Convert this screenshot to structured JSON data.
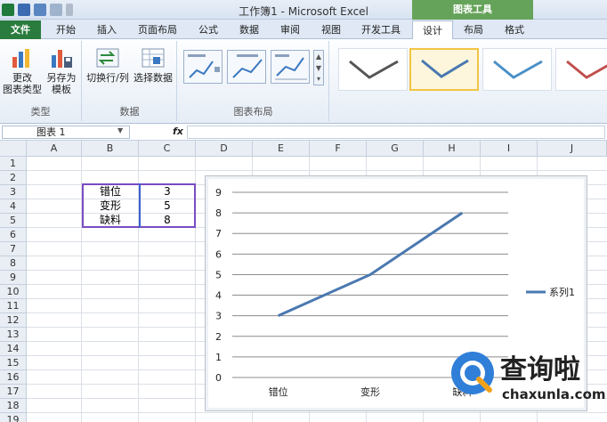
{
  "app": {
    "title": "工作簿1 - Microsoft Excel",
    "contextual_group": "图表工具"
  },
  "tabs": [
    {
      "label": "文件"
    },
    {
      "label": "开始"
    },
    {
      "label": "插入"
    },
    {
      "label": "页面布局"
    },
    {
      "label": "公式"
    },
    {
      "label": "数据"
    },
    {
      "label": "审阅"
    },
    {
      "label": "视图"
    },
    {
      "label": "开发工具"
    },
    {
      "label": "设计"
    },
    {
      "label": "布局"
    },
    {
      "label": "格式"
    }
  ],
  "ribbon": {
    "change_type_label": "更改\n图表类型",
    "save_template_label": "另存为\n模板",
    "switch_rowcol_label": "切换行/列",
    "select_data_label": "选择数据",
    "group_type": "类型",
    "group_data": "数据",
    "group_layout": "图表布局"
  },
  "formula_bar": {
    "name_box": "图表 1",
    "fx": "fx"
  },
  "sheet": {
    "columns": [
      "A",
      "B",
      "C",
      "D",
      "E",
      "F",
      "G",
      "H",
      "I",
      "J"
    ],
    "rows": [
      "1",
      "2",
      "3",
      "4",
      "5",
      "6",
      "7",
      "8",
      "9",
      "10",
      "11",
      "12",
      "13",
      "14",
      "15",
      "16",
      "17",
      "18",
      "19"
    ],
    "cells": [
      {
        "label": "错位",
        "value": "3"
      },
      {
        "label": "变形",
        "value": "5"
      },
      {
        "label": "缺料",
        "value": "8"
      }
    ]
  },
  "chart_data": {
    "type": "line",
    "categories": [
      "错位",
      "变形",
      "缺料"
    ],
    "series": [
      {
        "name": "系列1",
        "values": [
          3,
          5,
          8
        ]
      }
    ],
    "ylim": [
      0,
      9
    ],
    "yticks": [
      "0",
      "1",
      "2",
      "3",
      "4",
      "5",
      "6",
      "7",
      "8",
      "9"
    ],
    "grid": true,
    "legend": "right",
    "series_color": "#4a78b0"
  },
  "watermark": {
    "text": "查询啦",
    "url": "chaxunla.com"
  }
}
